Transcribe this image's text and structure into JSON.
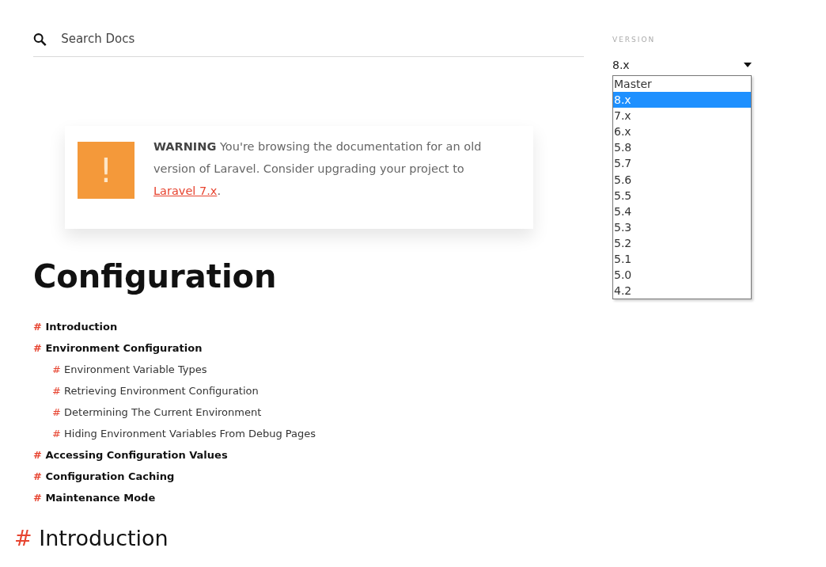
{
  "search": {
    "placeholder": "Search Docs"
  },
  "version": {
    "label": "VERSION",
    "value": "8.x",
    "expanded": true,
    "options": [
      {
        "label": "Master",
        "selected": false
      },
      {
        "label": "8.x",
        "selected": true
      },
      {
        "label": "7.x",
        "selected": false
      },
      {
        "label": "6.x",
        "selected": false
      },
      {
        "label": "5.8",
        "selected": false
      },
      {
        "label": "5.7",
        "selected": false
      },
      {
        "label": "5.6",
        "selected": false
      },
      {
        "label": "5.5",
        "selected": false
      },
      {
        "label": "5.4",
        "selected": false
      },
      {
        "label": "5.3",
        "selected": false
      },
      {
        "label": "5.2",
        "selected": false
      },
      {
        "label": "5.1",
        "selected": false
      },
      {
        "label": "5.0",
        "selected": false
      },
      {
        "label": "4.2",
        "selected": false
      }
    ]
  },
  "warning": {
    "icon": "!",
    "text": "**WARNING** You're browsing the documentation for an old version of Laravel. Consider upgrading your project to",
    "link": "Laravel 7.x",
    "after": "."
  },
  "title": "Configuration",
  "toc": [
    {
      "marker": "#",
      "label": "Introduction"
    },
    {
      "marker": "#",
      "label": "Environment Configuration",
      "children": [
        {
          "marker": "#",
          "label": "Environment Variable Types"
        },
        {
          "marker": "#",
          "label": "Retrieving Environment Configuration"
        },
        {
          "marker": "#",
          "label": "Determining The Current Environment"
        },
        {
          "marker": "#",
          "label": "Hiding Environment Variables From Debug Pages"
        }
      ]
    },
    {
      "marker": "#",
      "label": "Accessing Configuration Values"
    },
    {
      "marker": "#",
      "label": "Configuration Caching"
    },
    {
      "marker": "#",
      "label": "Maintenance Mode"
    }
  ],
  "section": {
    "marker": "#",
    "title": "Introduction"
  }
}
